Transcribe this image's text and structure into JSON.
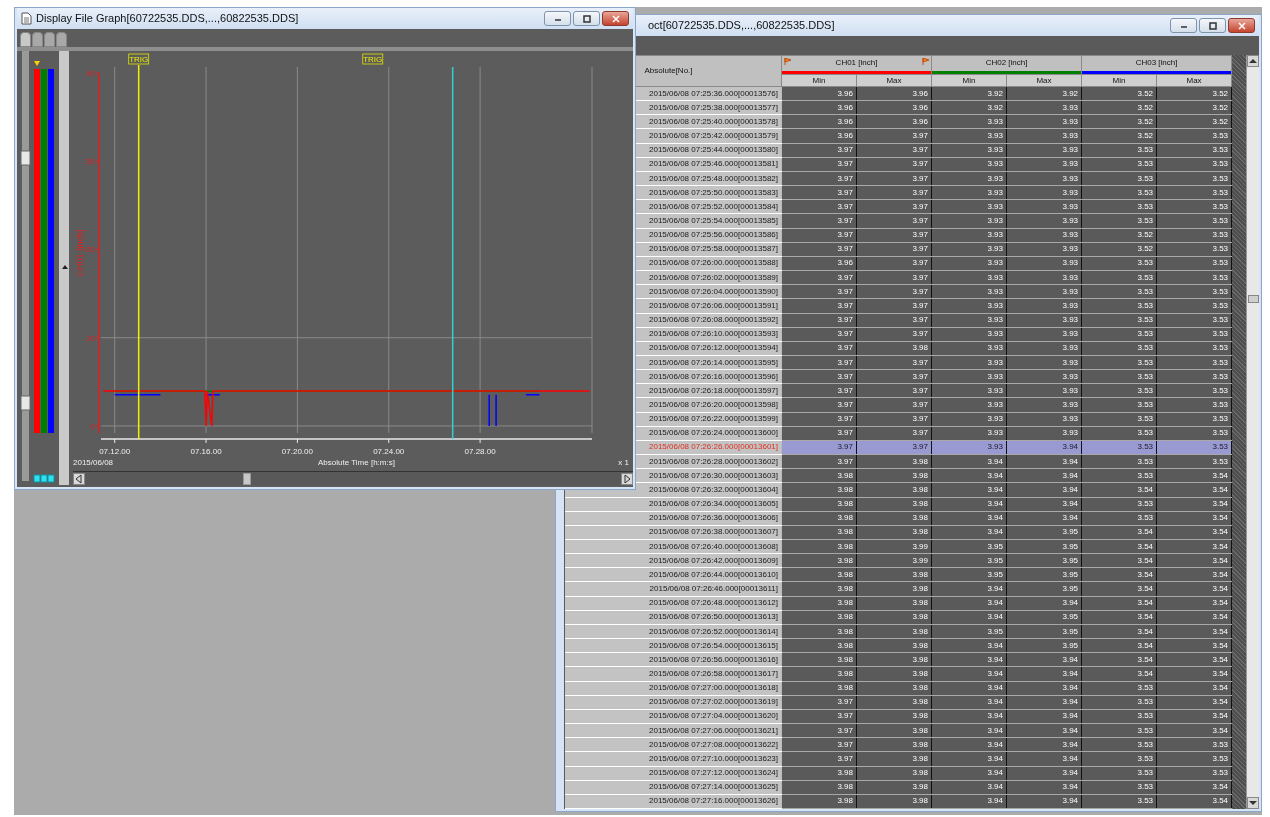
{
  "graph_window": {
    "title": "Display File Graph[60722535.DDS,...,60822535.DDS]",
    "tabs": [
      {
        "selected": true
      },
      {
        "selected": false
      },
      {
        "selected": false
      },
      {
        "selected": false
      }
    ],
    "date_label": "2015/06/08",
    "zoom_label": "x 1",
    "cursors": [
      {
        "kind": "trigger",
        "label": "TRIG"
      },
      {
        "kind": "marker",
        "label": "TRIG"
      },
      {
        "kind": "cursor"
      }
    ],
    "y_axis_title": "CH01 [inch]",
    "y_ticks": [
      "40",
      "30",
      "20",
      "10",
      "0"
    ],
    "x_axis_title": "Absolute Time [h:m:s]",
    "x_ticks": [
      "07.12.00",
      "07.16.00",
      "07.20.00",
      "07.24.00",
      "07.28.00"
    ]
  },
  "table_window": {
    "title": "oct[60722535.DDS,...,60822535.DDS]",
    "row_header_title": "Absolute[No.]",
    "channels": [
      {
        "name": "CH01 [inch]",
        "color": "#ff0000",
        "flags": true,
        "columns": [
          "Min",
          "Max"
        ]
      },
      {
        "name": "CH02 [inch]",
        "color": "#008000",
        "flags": false,
        "columns": [
          "Min",
          "Max"
        ]
      },
      {
        "name": "CH03 [inch]",
        "color": "#0000ff",
        "flags": false,
        "columns": [
          "Min",
          "Max"
        ]
      }
    ],
    "rows": [
      {
        "label": "2015/06/08 07:25:36.000[00013576]",
        "values": [
          "3.96",
          "3.96",
          "3.92",
          "3.92",
          "3.52",
          "3.52"
        ],
        "selected": false
      },
      {
        "label": "2015/06/08 07:25:38.000[00013577]",
        "values": [
          "3.96",
          "3.96",
          "3.92",
          "3.93",
          "3.52",
          "3.52"
        ],
        "selected": false
      },
      {
        "label": "2015/06/08 07:25:40.000[00013578]",
        "values": [
          "3.96",
          "3.96",
          "3.93",
          "3.93",
          "3.52",
          "3.52"
        ],
        "selected": false
      },
      {
        "label": "2015/06/08 07:25:42.000[00013579]",
        "values": [
          "3.96",
          "3.97",
          "3.93",
          "3.93",
          "3.52",
          "3.53"
        ],
        "selected": false
      },
      {
        "label": "2015/06/08 07:25:44.000[00013580]",
        "values": [
          "3.97",
          "3.97",
          "3.93",
          "3.93",
          "3.53",
          "3.53"
        ],
        "selected": false
      },
      {
        "label": "2015/06/08 07:25:46.000[00013581]",
        "values": [
          "3.97",
          "3.97",
          "3.93",
          "3.93",
          "3.53",
          "3.53"
        ],
        "selected": false
      },
      {
        "label": "2015/06/08 07:25:48.000[00013582]",
        "values": [
          "3.97",
          "3.97",
          "3.93",
          "3.93",
          "3.53",
          "3.53"
        ],
        "selected": false
      },
      {
        "label": "2015/06/08 07:25:50.000[00013583]",
        "values": [
          "3.97",
          "3.97",
          "3.93",
          "3.93",
          "3.53",
          "3.53"
        ],
        "selected": false
      },
      {
        "label": "2015/06/08 07:25:52.000[00013584]",
        "values": [
          "3.97",
          "3.97",
          "3.93",
          "3.93",
          "3.53",
          "3.53"
        ],
        "selected": false
      },
      {
        "label": "2015/06/08 07:25:54.000[00013585]",
        "values": [
          "3.97",
          "3.97",
          "3.93",
          "3.93",
          "3.53",
          "3.53"
        ],
        "selected": false
      },
      {
        "label": "2015/06/08 07:25:56.000[00013586]",
        "values": [
          "3.97",
          "3.97",
          "3.93",
          "3.93",
          "3.52",
          "3.53"
        ],
        "selected": false
      },
      {
        "label": "2015/06/08 07:25:58.000[00013587]",
        "values": [
          "3.97",
          "3.97",
          "3.93",
          "3.93",
          "3.52",
          "3.53"
        ],
        "selected": false
      },
      {
        "label": "2015/06/08 07:26:00.000[00013588]",
        "values": [
          "3.96",
          "3.97",
          "3.93",
          "3.93",
          "3.53",
          "3.53"
        ],
        "selected": false
      },
      {
        "label": "2015/06/08 07:26:02.000[00013589]",
        "values": [
          "3.97",
          "3.97",
          "3.93",
          "3.93",
          "3.53",
          "3.53"
        ],
        "selected": false
      },
      {
        "label": "2015/06/08 07:26:04.000[00013590]",
        "values": [
          "3.97",
          "3.97",
          "3.93",
          "3.93",
          "3.53",
          "3.53"
        ],
        "selected": false
      },
      {
        "label": "2015/06/08 07:26:06.000[00013591]",
        "values": [
          "3.97",
          "3.97",
          "3.93",
          "3.93",
          "3.53",
          "3.53"
        ],
        "selected": false
      },
      {
        "label": "2015/06/08 07:26:08.000[00013592]",
        "values": [
          "3.97",
          "3.97",
          "3.93",
          "3.93",
          "3.53",
          "3.53"
        ],
        "selected": false
      },
      {
        "label": "2015/06/08 07:26:10.000[00013593]",
        "values": [
          "3.97",
          "3.97",
          "3.93",
          "3.93",
          "3.53",
          "3.53"
        ],
        "selected": false
      },
      {
        "label": "2015/06/08 07:26:12.000[00013594]",
        "values": [
          "3.97",
          "3.98",
          "3.93",
          "3.93",
          "3.53",
          "3.53"
        ],
        "selected": false
      },
      {
        "label": "2015/06/08 07:26:14.000[00013595]",
        "values": [
          "3.97",
          "3.97",
          "3.93",
          "3.93",
          "3.53",
          "3.53"
        ],
        "selected": false
      },
      {
        "label": "2015/06/08 07:26:16.000[00013596]",
        "values": [
          "3.97",
          "3.97",
          "3.93",
          "3.93",
          "3.53",
          "3.53"
        ],
        "selected": false
      },
      {
        "label": "2015/06/08 07:26:18.000[00013597]",
        "values": [
          "3.97",
          "3.97",
          "3.93",
          "3.93",
          "3.53",
          "3.53"
        ],
        "selected": false
      },
      {
        "label": "2015/06/08 07:26:20.000[00013598]",
        "values": [
          "3.97",
          "3.97",
          "3.93",
          "3.93",
          "3.53",
          "3.53"
        ],
        "selected": false
      },
      {
        "label": "2015/06/08 07:26:22.000[00013599]",
        "values": [
          "3.97",
          "3.97",
          "3.93",
          "3.93",
          "3.53",
          "3.53"
        ],
        "selected": false
      },
      {
        "label": "2015/06/08 07:26:24.000[00013600]",
        "values": [
          "3.97",
          "3.97",
          "3.93",
          "3.93",
          "3.53",
          "3.53"
        ],
        "selected": false
      },
      {
        "label": "2015/06/08 07:26:26.000[00013601]",
        "values": [
          "3.97",
          "3.97",
          "3.93",
          "3.94",
          "3.53",
          "3.53"
        ],
        "selected": true
      },
      {
        "label": "2015/06/08 07:26:28.000[00013602]",
        "values": [
          "3.97",
          "3.98",
          "3.94",
          "3.94",
          "3.53",
          "3.53"
        ],
        "selected": false
      },
      {
        "label": "2015/06/08 07:26:30.000[00013603]",
        "values": [
          "3.98",
          "3.98",
          "3.94",
          "3.94",
          "3.53",
          "3.54"
        ],
        "selected": false
      },
      {
        "label": "2015/06/08 07:26:32.000[00013604]",
        "values": [
          "3.98",
          "3.98",
          "3.94",
          "3.94",
          "3.54",
          "3.54"
        ],
        "selected": false
      },
      {
        "label": "2015/06/08 07:26:34.000[00013605]",
        "values": [
          "3.98",
          "3.98",
          "3.94",
          "3.94",
          "3.53",
          "3.54"
        ],
        "selected": false
      },
      {
        "label": "2015/06/08 07:26:36.000[00013606]",
        "values": [
          "3.98",
          "3.98",
          "3.94",
          "3.94",
          "3.53",
          "3.54"
        ],
        "selected": false
      },
      {
        "label": "2015/06/08 07:26:38.000[00013607]",
        "values": [
          "3.98",
          "3.98",
          "3.94",
          "3.95",
          "3.54",
          "3.54"
        ],
        "selected": false
      },
      {
        "label": "2015/06/08 07:26:40.000[00013608]",
        "values": [
          "3.98",
          "3.99",
          "3.95",
          "3.95",
          "3.54",
          "3.54"
        ],
        "selected": false
      },
      {
        "label": "2015/06/08 07:26:42.000[00013609]",
        "values": [
          "3.98",
          "3.99",
          "3.95",
          "3.95",
          "3.54",
          "3.54"
        ],
        "selected": false
      },
      {
        "label": "2015/06/08 07:26:44.000[00013610]",
        "values": [
          "3.98",
          "3.98",
          "3.95",
          "3.95",
          "3.54",
          "3.54"
        ],
        "selected": false
      },
      {
        "label": "2015/06/08 07:26:46.000[00013611]",
        "values": [
          "3.98",
          "3.98",
          "3.94",
          "3.95",
          "3.54",
          "3.54"
        ],
        "selected": false
      },
      {
        "label": "2015/06/08 07:26:48.000[00013612]",
        "values": [
          "3.98",
          "3.98",
          "3.94",
          "3.94",
          "3.54",
          "3.54"
        ],
        "selected": false
      },
      {
        "label": "2015/06/08 07:26:50.000[00013613]",
        "values": [
          "3.98",
          "3.98",
          "3.94",
          "3.95",
          "3.54",
          "3.54"
        ],
        "selected": false
      },
      {
        "label": "2015/06/08 07:26:52.000[00013614]",
        "values": [
          "3.98",
          "3.98",
          "3.95",
          "3.95",
          "3.54",
          "3.54"
        ],
        "selected": false
      },
      {
        "label": "2015/06/08 07:26:54.000[00013615]",
        "values": [
          "3.98",
          "3.98",
          "3.94",
          "3.95",
          "3.54",
          "3.54"
        ],
        "selected": false
      },
      {
        "label": "2015/06/08 07:26:56.000[00013616]",
        "values": [
          "3.98",
          "3.98",
          "3.94",
          "3.94",
          "3.54",
          "3.54"
        ],
        "selected": false
      },
      {
        "label": "2015/06/08 07:26:58.000[00013617]",
        "values": [
          "3.98",
          "3.98",
          "3.94",
          "3.94",
          "3.54",
          "3.54"
        ],
        "selected": false
      },
      {
        "label": "2015/06/08 07:27:00.000[00013618]",
        "values": [
          "3.98",
          "3.98",
          "3.94",
          "3.94",
          "3.53",
          "3.54"
        ],
        "selected": false
      },
      {
        "label": "2015/06/08 07:27:02.000[00013619]",
        "values": [
          "3.97",
          "3.98",
          "3.94",
          "3.94",
          "3.53",
          "3.54"
        ],
        "selected": false
      },
      {
        "label": "2015/06/08 07:27:04.000[00013620]",
        "values": [
          "3.97",
          "3.98",
          "3.94",
          "3.94",
          "3.53",
          "3.54"
        ],
        "selected": false
      },
      {
        "label": "2015/06/08 07:27:06.000[00013621]",
        "values": [
          "3.97",
          "3.98",
          "3.94",
          "3.94",
          "3.53",
          "3.54"
        ],
        "selected": false
      },
      {
        "label": "2015/06/08 07:27:08.000[00013622]",
        "values": [
          "3.97",
          "3.98",
          "3.94",
          "3.94",
          "3.53",
          "3.53"
        ],
        "selected": false
      },
      {
        "label": "2015/06/08 07:27:10.000[00013623]",
        "values": [
          "3.97",
          "3.98",
          "3.94",
          "3.94",
          "3.53",
          "3.53"
        ],
        "selected": false
      },
      {
        "label": "2015/06/08 07:27:12.000[00013624]",
        "values": [
          "3.98",
          "3.98",
          "3.94",
          "3.94",
          "3.53",
          "3.53"
        ],
        "selected": false
      },
      {
        "label": "2015/06/08 07:27:14.000[00013625]",
        "values": [
          "3.98",
          "3.98",
          "3.94",
          "3.94",
          "3.53",
          "3.54"
        ],
        "selected": false
      },
      {
        "label": "2015/06/08 07:27:16.000[00013626]",
        "values": [
          "3.98",
          "3.98",
          "3.94",
          "3.94",
          "3.53",
          "3.54"
        ],
        "selected": false
      }
    ]
  }
}
